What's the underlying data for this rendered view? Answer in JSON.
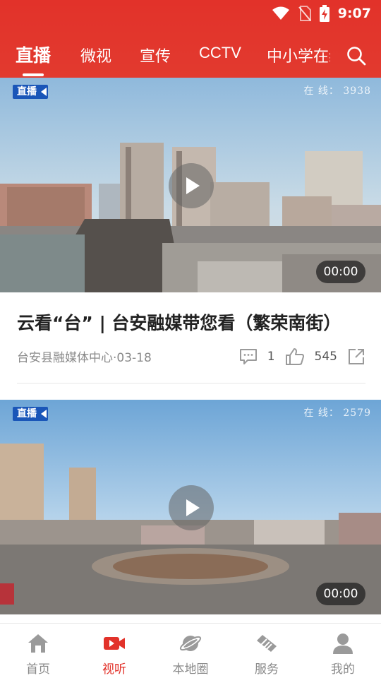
{
  "status_bar": {
    "time": "9:07"
  },
  "tabs": [
    {
      "label": "直播",
      "active": true
    },
    {
      "label": "微视"
    },
    {
      "label": "宣传"
    },
    {
      "label": "CCTV"
    },
    {
      "label": "中小学在线"
    }
  ],
  "colors": {
    "accent": "#e2322a",
    "live_badge": "#1a56b8"
  },
  "feed": [
    {
      "badge": "直播",
      "online": "在 线： 3938",
      "duration": "00:00",
      "title": "云看“台” | 台安融媒带您看（繁荣南街）",
      "source": "台安县融媒体中心·03-18",
      "comments": "1",
      "likes": "545"
    },
    {
      "badge": "直播",
      "online": "在 线： 2579",
      "duration": "00:00"
    }
  ],
  "bottom_nav": [
    {
      "label": "首页",
      "icon": "home-icon"
    },
    {
      "label": "视听",
      "icon": "video-icon",
      "active": true
    },
    {
      "label": "本地圈",
      "icon": "planet-icon"
    },
    {
      "label": "服务",
      "icon": "handshake-icon"
    },
    {
      "label": "我的",
      "icon": "user-icon"
    }
  ]
}
